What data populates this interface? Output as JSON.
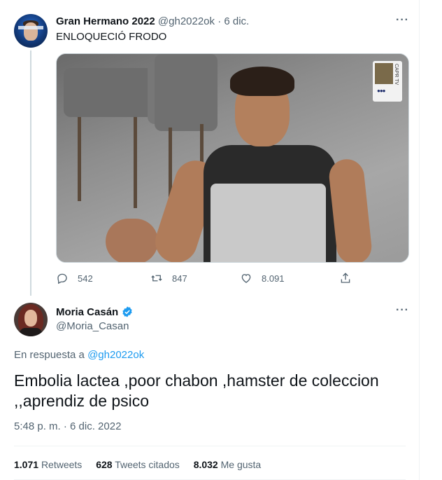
{
  "tweet1": {
    "display_name": "Gran Hermano 2022",
    "handle_date": "@gh2022ok · 6 dic.",
    "text": "ENLOQUECIÓ FRODO",
    "media_watermark": "CAPR TV",
    "more_icon": "more-dots-icon",
    "actions": {
      "replies": "542",
      "retweets": "847",
      "likes": "8.091"
    }
  },
  "tweet2": {
    "display_name": "Moria Casán",
    "handle": "@Moria_Casan",
    "verified_icon": "verified-badge-icon",
    "reply_prefix": "En respuesta a",
    "reply_handle": "@gh2022ok",
    "text": "Embolia lactea ,poor chabon ,hamster de coleccion ,,aprendiz de psico",
    "timestamp": "5:48 p. m. · 6 dic. 2022",
    "stats": {
      "retweets_value": "1.071",
      "retweets_label": "Retweets",
      "quotes_value": "628",
      "quotes_label": "Tweets citados",
      "likes_value": "8.032",
      "likes_label": "Me gusta"
    }
  },
  "colors": {
    "accent": "#1d9bf0",
    "text_primary": "#0f1419",
    "text_secondary": "#536471",
    "border": "#eff3f4"
  }
}
